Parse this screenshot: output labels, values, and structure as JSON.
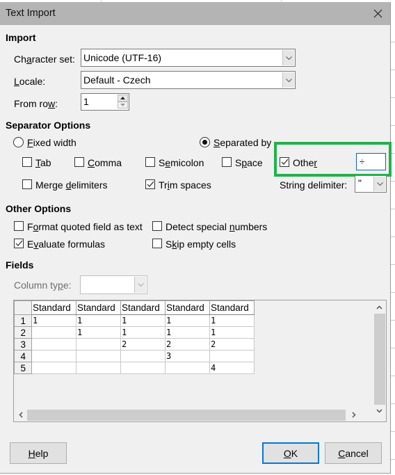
{
  "window": {
    "title": "Text Import",
    "close_icon": "close-icon"
  },
  "import": {
    "heading": "Import",
    "character_set": {
      "label_pre": "Ch",
      "label_ul": "a",
      "label_post": "racter set:",
      "value": "Unicode (UTF-16)"
    },
    "locale": {
      "label_ul": "L",
      "label_post": "ocale:",
      "value": "Default - Czech"
    },
    "from_row": {
      "label_pre": "From ro",
      "label_ul": "w",
      "label_post": ":",
      "value": "1"
    }
  },
  "separator_options": {
    "heading": "Separator Options",
    "fixed_width": {
      "label_ul": "F",
      "label_post": "ixed width",
      "selected": false
    },
    "separated_by": {
      "label_ul": "S",
      "label_post": "eparated by",
      "selected": true
    },
    "tab": {
      "label_ul": "T",
      "label_post": "ab",
      "checked": false
    },
    "comma": {
      "label_ul": "C",
      "label_post": "omma",
      "checked": false
    },
    "semicolon": {
      "label_pre": "S",
      "label_ul": "e",
      "label_post": "micolon",
      "checked": false
    },
    "space": {
      "label_pre": "S",
      "label_ul": "p",
      "label_post": "ace",
      "checked": false
    },
    "other": {
      "label_pre": "Othe",
      "label_ul": "r",
      "checked": true,
      "value": "÷"
    },
    "merge_delimiters": {
      "label_pre": "Merge ",
      "label_ul": "d",
      "label_post": "elimiters",
      "checked": false
    },
    "trim_spaces": {
      "label_pre": "Tr",
      "label_ul": "i",
      "label_post": "m spaces",
      "checked": true
    },
    "string_delimiter": {
      "label_pre": "Strin",
      "label_ul": "g",
      "label_post": " delimiter:",
      "value": "\""
    }
  },
  "other_options": {
    "heading": "Other Options",
    "format_quoted": {
      "label_pre": "F",
      "label_ul": "o",
      "label_post": "rmat quoted field as text",
      "checked": false
    },
    "detect_special": {
      "label_pre": "Detect special ",
      "label_ul": "n",
      "label_post": "umbers",
      "checked": false
    },
    "evaluate_formulas": {
      "label_pre": "E",
      "label_ul": "v",
      "label_post": "aluate formulas",
      "checked": true
    },
    "skip_empty": {
      "label_pre": "S",
      "label_ul": "k",
      "label_post": "ip empty cells",
      "checked": false
    }
  },
  "fields": {
    "heading": "Fields",
    "column_type": {
      "label_pre": "Column ty",
      "label_ul": "p",
      "label_post": "e:",
      "value": "",
      "disabled": true
    },
    "columns": [
      "Standard",
      "Standard",
      "Standard",
      "Standard",
      "Standard"
    ],
    "rows": [
      {
        "num": "1",
        "cells": [
          "1",
          "1",
          "1",
          "1",
          "1"
        ]
      },
      {
        "num": "2",
        "cells": [
          "",
          "1",
          "1",
          "1",
          "1"
        ]
      },
      {
        "num": "3",
        "cells": [
          "",
          "",
          "2",
          "2",
          "2"
        ]
      },
      {
        "num": "4",
        "cells": [
          "",
          "",
          "",
          "3",
          ""
        ]
      },
      {
        "num": "5",
        "cells": [
          "",
          "",
          "",
          "",
          "4"
        ]
      }
    ]
  },
  "buttons": {
    "help": {
      "label_ul": "H",
      "label_post": "elp"
    },
    "ok": {
      "label_ul": "O",
      "label_post": "K"
    },
    "cancel": {
      "label_ul": "C",
      "label_post": "ancel"
    }
  },
  "colors": {
    "highlight": "#22b14c",
    "focus": "#0078d7"
  }
}
